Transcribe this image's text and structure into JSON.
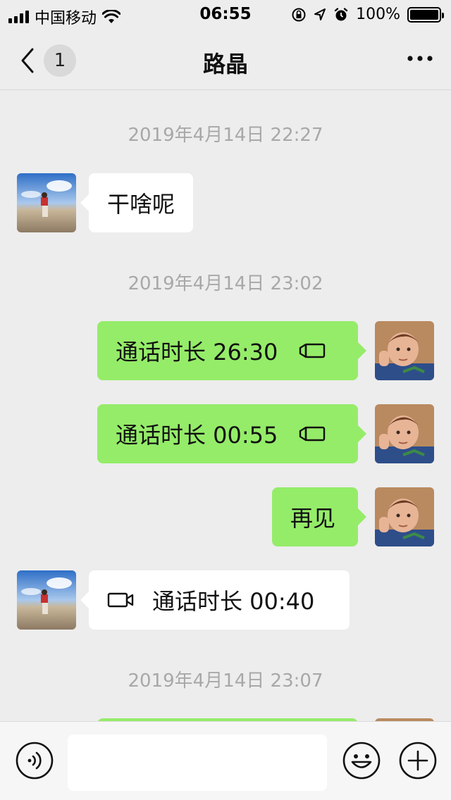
{
  "status_bar": {
    "carrier": "中国移动",
    "time": "06:55",
    "battery": "100%"
  },
  "nav": {
    "back_badge": "1",
    "title": "路晶"
  },
  "messages": [
    {
      "kind": "timestamp",
      "text": "2019年4月14日 22:27"
    },
    {
      "kind": "received",
      "text": "干啥呢"
    },
    {
      "kind": "timestamp",
      "text": "2019年4月14日 23:02"
    },
    {
      "kind": "sent_call",
      "text": "通话时长 26:30",
      "icon": "video-call-icon"
    },
    {
      "kind": "sent_call",
      "text": "通话时长 00:55",
      "icon": "video-call-icon"
    },
    {
      "kind": "sent",
      "text": "再见"
    },
    {
      "kind": "received_call",
      "text": "通话时长 00:40",
      "icon": "video-call-icon"
    },
    {
      "kind": "timestamp",
      "text": "2019年4月14日 23:07"
    }
  ],
  "input_bar": {
    "voice_icon": "voice-icon",
    "emoji_icon": "emoji-icon",
    "plus_icon": "plus-icon",
    "input_value": ""
  },
  "colors": {
    "sent_bubble": "#95ec69",
    "received_bubble": "#ffffff",
    "background": "#ededed"
  }
}
